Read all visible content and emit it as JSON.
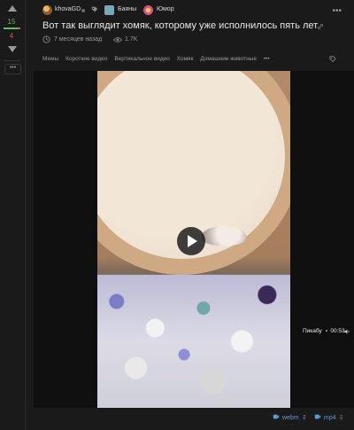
{
  "rail": {
    "plus": "15",
    "minus": "4"
  },
  "header": {
    "author": "khovaGD",
    "communities": [
      "Баяны",
      "Юмор"
    ]
  },
  "post": {
    "title": "Вот так выглядит хомяк, которому уже исполнилось пять лет",
    "time": "7 месяцев назад",
    "views": "1.7K",
    "tags": [
      "Мемы",
      "Короткие видео",
      "Вертикальное видео",
      "Хомяк",
      "Домашние животные"
    ],
    "tags_more": "•••"
  },
  "video": {
    "source": "Пикабу",
    "duration": "00:53"
  },
  "downloads": {
    "webm": "webm",
    "mp4": "mp4"
  },
  "icons": {
    "up": "arrow-up-icon",
    "down": "arrow-down-icon",
    "more": "kebab-icon",
    "tag": "tag-icon",
    "link": "link-icon",
    "clock": "clock-icon",
    "eye": "eye-icon",
    "play": "play-icon",
    "volume": "volume-icon",
    "download": "download-icon"
  },
  "colors": {
    "plus": "#5fbf5f",
    "minus": "#d65b5b",
    "link": "#5b9bd5",
    "bg": "#1a1a1b"
  }
}
